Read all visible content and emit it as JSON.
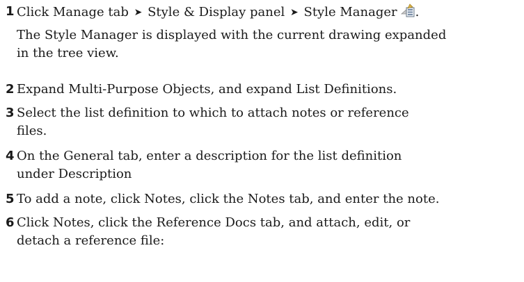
{
  "steps": [
    {
      "number": "1",
      "parts": [
        "Click Manage tab",
        "Style & Display panel",
        "Style Manager"
      ],
      "icon": "style-manager-icon",
      "trailing": ".",
      "result": "The Style Manager is displayed with the current drawing expanded\nin the tree view."
    },
    {
      "number": "2",
      "text": "Expand Multi-Purpose Objects, and expand List Definitions."
    },
    {
      "number": "3",
      "text": "Select the list definition to which to attach notes or reference\nfiles."
    },
    {
      "number": "4",
      "text": "On the General tab, enter a description for the list definition\nunder Description"
    },
    {
      "number": "5",
      "text": "To add a note, click Notes, click the Notes tab, and enter the note."
    },
    {
      "number": "6",
      "text": "Click Notes, click the Reference Docs tab, and attach, edit, or\ndetach a reference file:"
    }
  ],
  "arrow_glyph": "➤"
}
